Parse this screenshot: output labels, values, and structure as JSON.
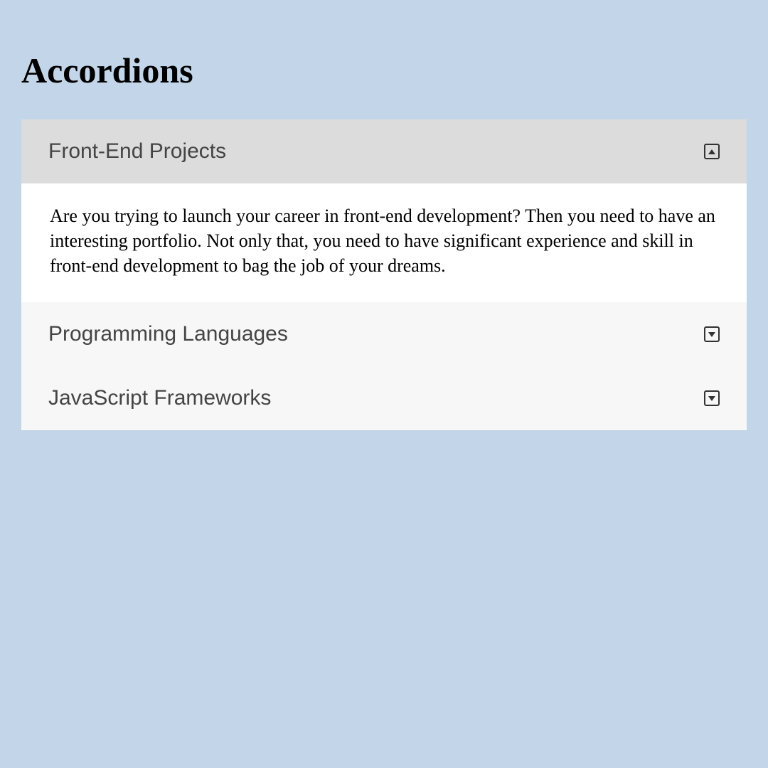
{
  "header": {
    "title": "Accordions"
  },
  "accordion": {
    "items": [
      {
        "title": "Front-End Projects",
        "expanded": true,
        "content": "Are you trying to launch your career in front-end development? Then you need to have an interesting portfolio. Not only that, you need to have significant experience and skill in front-end development to bag the job of your dreams."
      },
      {
        "title": "Programming Languages",
        "expanded": false
      },
      {
        "title": "JavaScript Frameworks",
        "expanded": false
      }
    ]
  }
}
